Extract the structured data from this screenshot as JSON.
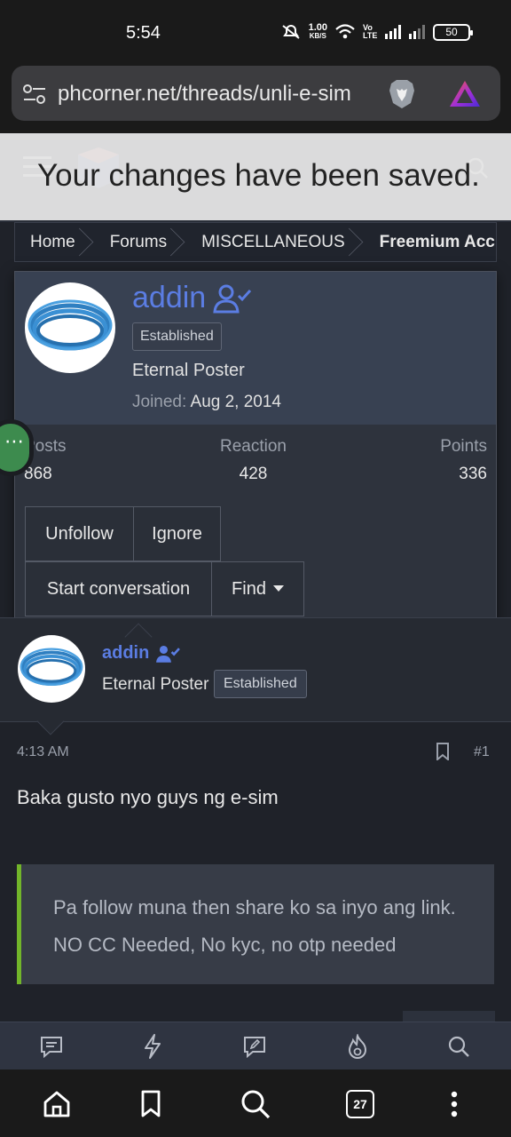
{
  "status_bar": {
    "time": "5:54",
    "net_speed": "1.00",
    "net_speed_unit": "KB/S",
    "lte_label": "Vo LTE",
    "battery": "50"
  },
  "browser": {
    "url": "phcorner.net/threads/unli-e-sim",
    "tab_count": "27"
  },
  "toast": {
    "message": "Your changes have been saved."
  },
  "breadcrumb": [
    {
      "label": "Home"
    },
    {
      "label": "Forums"
    },
    {
      "label": "MISCELLANEOUS"
    },
    {
      "label": "Freemium Acc"
    }
  ],
  "member_card": {
    "username": "addin",
    "banner": "Established",
    "user_title": "Eternal Poster",
    "joined_label": "Joined:",
    "joined_date": "Aug 2, 2014",
    "stats": [
      {
        "label": "Posts",
        "value": "868"
      },
      {
        "label": "Reaction",
        "value": "428"
      },
      {
        "label": "Points",
        "value": "336"
      }
    ],
    "buttons": {
      "unfollow": "Unfollow",
      "ignore": "Ignore",
      "start_conversation": "Start conversation",
      "find": "Find"
    }
  },
  "post": {
    "username": "addin",
    "user_title": "Eternal Poster",
    "banner": "Established",
    "time": "4:13 AM",
    "number": "#1",
    "body": "Baka gusto nyo guys ng e-sim",
    "quote": "Pa follow muna then share ko sa inyo ang link. NO CC Needed, No kyc, no otp needed"
  },
  "colors": {
    "accent_link": "#5b7de3",
    "quote_border": "#72b52a",
    "background": "#1f2229"
  }
}
